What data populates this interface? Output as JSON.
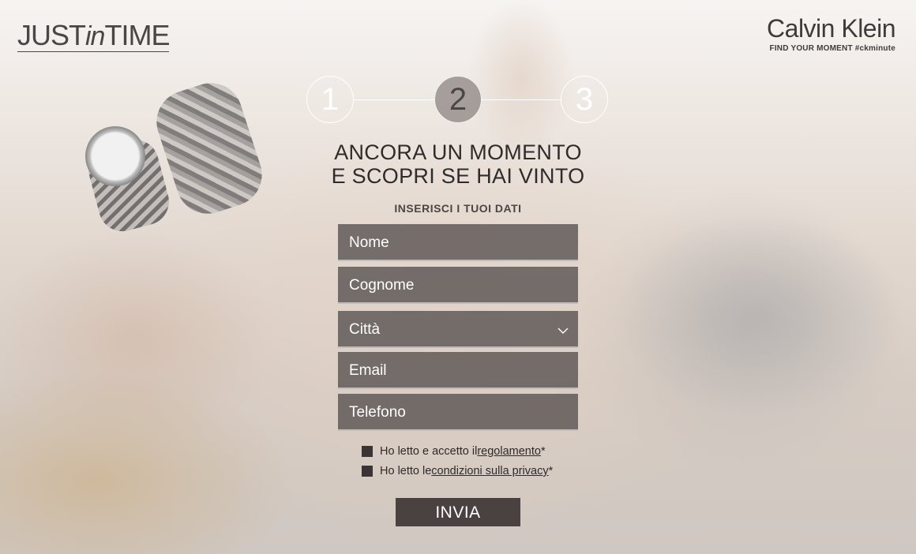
{
  "header": {
    "logo_left_a": "JUST",
    "logo_left_b": "in",
    "logo_left_c": "TIME",
    "brand": "Calvin Klein",
    "tagline": "FIND YOUR MOMENT #ckminute"
  },
  "steps": {
    "items": [
      "1",
      "2",
      "3"
    ],
    "active": 2
  },
  "headline": {
    "line1": "ANCORA UN MOMENTO",
    "line2": "E SCOPRI SE HAI VINTO"
  },
  "form": {
    "subtitle": "INSERISCI I TUOI DATI",
    "fields": {
      "nome": "Nome",
      "cognome": "Cognome",
      "citta": "Città",
      "email": "Email",
      "telefono": "Telefono"
    },
    "consent1": {
      "prefix": "Ho letto e accetto il ",
      "link": "regolamento",
      "suffix": "*"
    },
    "consent2": {
      "prefix": "Ho letto le ",
      "link": "condizioni sulla privacy",
      "suffix": "*"
    },
    "submit": "INVIA"
  },
  "colors": {
    "field_bg": "#5c5554",
    "button_bg": "#4a4241",
    "text_dark": "#2f2b2b"
  }
}
